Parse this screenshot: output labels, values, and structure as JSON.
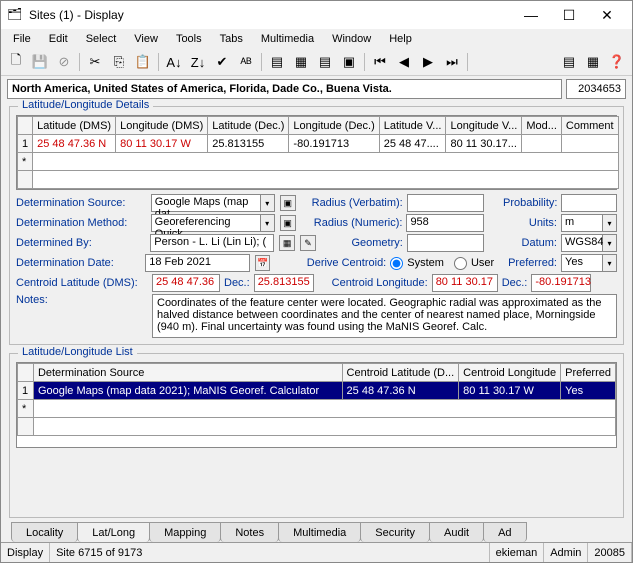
{
  "window": {
    "title": "Sites (1) - Display"
  },
  "menu": [
    "File",
    "Edit",
    "Select",
    "View",
    "Tools",
    "Tabs",
    "Multimedia",
    "Window",
    "Help"
  ],
  "location": "North America, United States of America, Florida, Dade Co., Buena Vista.",
  "site_id": "2034653",
  "details": {
    "title": "Latitude/Longitude Details",
    "headers": [
      "",
      "Latitude (DMS)",
      "Longitude (DMS)",
      "Latitude (Dec.)",
      "Longitude (Dec.)",
      "Latitude V...",
      "Longitude V...",
      "Mod...",
      "Comment"
    ],
    "row": {
      "idx": "1",
      "lat_dms": "25 48 47.36 N",
      "lon_dms": "80 11 30.17 W",
      "lat_dec": "25.813155",
      "lon_dec": "-80.191713",
      "lat_v": "25 48 47....",
      "lon_v": "80 11 30.17...",
      "mod": "",
      "comment": ""
    }
  },
  "form": {
    "det_source_label": "Determination Source:",
    "det_source": "Google Maps (map dat",
    "det_method_label": "Determination Method:",
    "det_method": "Georeferencing Quick",
    "det_by_label": "Determined By:",
    "det_by": "Person - L. Li (Lin Li); (",
    "det_date_label": "Determination Date:",
    "det_date": "18 Feb 2021",
    "centroid_lat_label": "Centroid Latitude (DMS):",
    "centroid_lat": "25 48 47.36",
    "dec_label": "Dec.:",
    "centroid_lat_dec": "25.813155",
    "centroid_lon_label": "Centroid Longitude:",
    "centroid_lon": "80 11 30.17",
    "centroid_lon_dec": "-80.191713",
    "radius_verbatim_label": "Radius (Verbatim):",
    "radius_verbatim": "",
    "radius_numeric_label": "Radius (Numeric):",
    "radius_numeric": "958",
    "geometry_label": "Geometry:",
    "geometry": "",
    "derive_label": "Derive Centroid:",
    "derive_system": "System",
    "derive_user": "User",
    "probability_label": "Probability:",
    "probability": "",
    "units_label": "Units:",
    "units": "m",
    "datum_label": "Datum:",
    "datum": "WGS84",
    "preferred_label": "Preferred:",
    "preferred": "Yes",
    "notes_label": "Notes:",
    "notes": "Coordinates of the feature center were located. Geographic radial was approximated as the halved distance between coordinates and the center of nearest named place, Morningside (940 m). Final uncertainty was found using the MaNIS Georef. Calc."
  },
  "list": {
    "title": "Latitude/Longitude List",
    "headers": [
      "",
      "Determination Source",
      "Centroid Latitude (D...",
      "Centroid Longitude",
      "Preferred"
    ],
    "row": {
      "idx": "1",
      "source": "Google Maps (map data 2021); MaNIS Georef. Calculator",
      "lat": "25 48 47.36 N",
      "lon": "80 11 30.17 W",
      "pref": "Yes"
    }
  },
  "tabs": [
    "Locality",
    "Lat/Long",
    "Mapping",
    "Notes",
    "Multimedia",
    "Security",
    "Audit",
    "Ad"
  ],
  "active_tab": 1,
  "status": {
    "mode": "Display",
    "record": "Site 6715 of 9173",
    "user": "ekieman",
    "role": "Admin",
    "port": "20085"
  }
}
